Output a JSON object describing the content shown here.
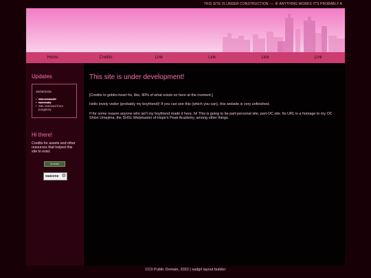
{
  "marquee": "THIS SITE IS UNDER CONSTRUCTION ---- IF ANYTHING WORKS IT'S PROBABLY A",
  "nav": {
    "items": [
      {
        "label": "Home"
      },
      {
        "label": "Credits"
      },
      {
        "label": "Link"
      },
      {
        "label": "Link"
      },
      {
        "label": "Link"
      },
      {
        "label": "Link"
      }
    ]
  },
  "sidebar": {
    "updates_title": "Updates",
    "update_date": "26/06/2025",
    "update_items": [
      "Site created?",
      "Not really",
      "Site removed from purgatory"
    ],
    "hi_title": "Hi there!",
    "credits_text": "Credits for assets and other resources that helped this site to exist:",
    "badge1_text": "neocities",
    "badge2_text": "waizone",
    "badge2_icon": "gear-wheel-icon"
  },
  "main": {
    "title": "This site is under development!",
    "p1": "[Credits to goblin-heart for, like, 90% of what exists on here at the moment.]",
    "p2": "Hello lovely visitor (probably my boyfriend)! If you can see this (which you can), this website is very unfinished.",
    "p3": "If for some reason anyone who isn't my boyfriend made it here, hi! This is going to be part-personal site, part-OC site. Its URL is a homage to my OC Shion Umejima, the SHSL Webmaster of Hope's Peak Academy, among other things."
  },
  "footer": "CC0 Public Domain, 2022 | sadgrl layout builder",
  "colors": {
    "background": "#170106",
    "nav": "#cb3d6f",
    "accent": "#ff6fb4",
    "sidebar": "#2b0310"
  }
}
